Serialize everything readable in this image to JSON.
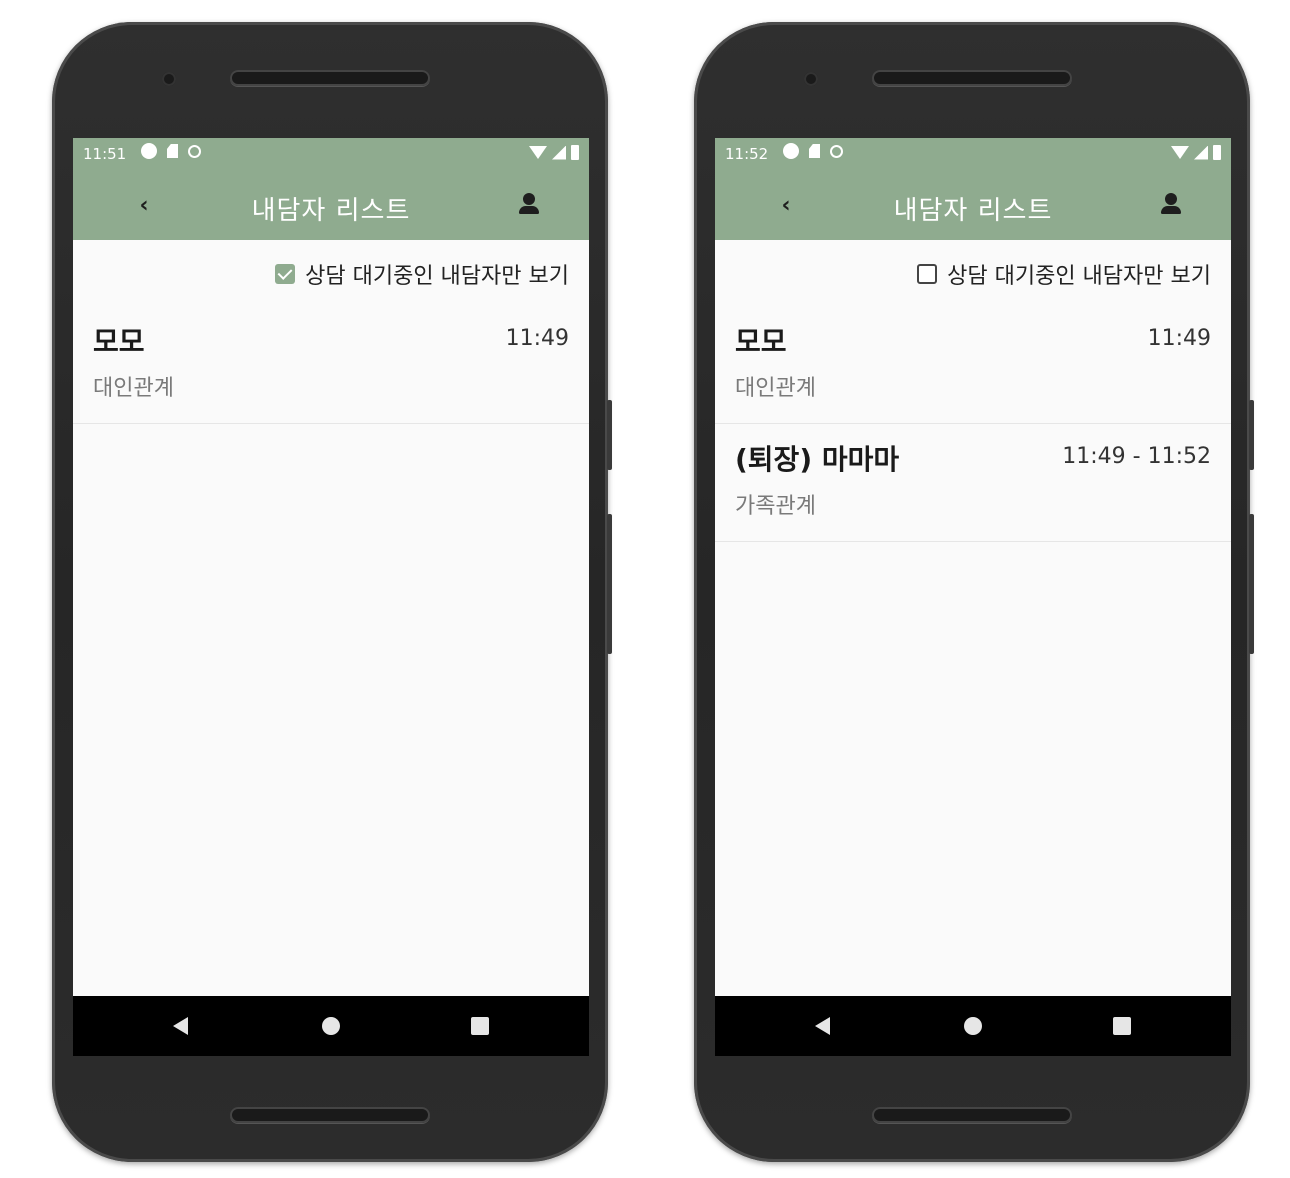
{
  "screens": [
    {
      "status": {
        "time": "11:51"
      },
      "appbar": {
        "title": "내담자 리스트"
      },
      "filter": {
        "label": "상담 대기중인 내담자만 보기",
        "checked": true
      },
      "clients": [
        {
          "name": "모모",
          "relation": "대인관계",
          "time": "11:49"
        }
      ]
    },
    {
      "status": {
        "time": "11:52"
      },
      "appbar": {
        "title": "내담자 리스트"
      },
      "filter": {
        "label": "상담 대기중인 내담자만 보기",
        "checked": false
      },
      "clients": [
        {
          "name": "모모",
          "relation": "대인관계",
          "time": "11:49"
        },
        {
          "name": "(퇴장) 마마마",
          "relation": "가족관계",
          "time": "11:49 - 11:52"
        }
      ]
    }
  ],
  "icons": {
    "back": "chevron-left-icon",
    "profile": "person-icon",
    "nav": [
      "back-triangle-icon",
      "home-circle-icon",
      "recents-square-icon"
    ]
  },
  "colors": {
    "appbar": "#8fab8f",
    "frame": "#2a2a2a",
    "background": "#fafafa"
  }
}
